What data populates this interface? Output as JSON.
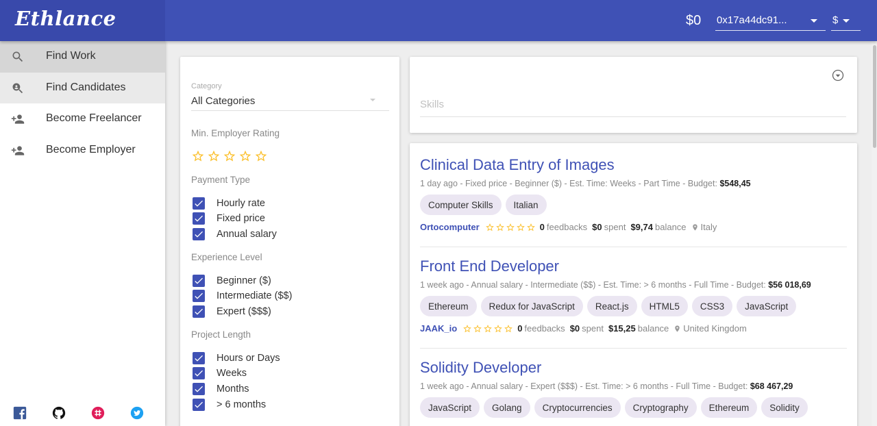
{
  "header": {
    "logo": "Ethlance",
    "balance": "$0",
    "address": "0x17a44dc91...",
    "currency": "$"
  },
  "sidebar": {
    "items": [
      {
        "label": "Find Work",
        "icon": "search-icon"
      },
      {
        "label": "Find Candidates",
        "icon": "person-search-icon"
      },
      {
        "label": "Become Freelancer",
        "icon": "person-add-icon"
      },
      {
        "label": "Become Employer",
        "icon": "person-add-icon"
      }
    ],
    "social": [
      {
        "icon": "facebook-icon",
        "color": "#3b5998"
      },
      {
        "icon": "github-icon",
        "color": "#111111"
      },
      {
        "icon": "slack-icon",
        "color": "#e01e5a"
      },
      {
        "icon": "twitter-icon",
        "color": "#1da1f2"
      }
    ]
  },
  "filters": {
    "category_label": "Category",
    "category_value": "All Categories",
    "min_rating_label": "Min. Employer Rating",
    "min_rating": 0,
    "payment_label": "Payment Type",
    "payment": [
      "Hourly rate",
      "Fixed price",
      "Annual salary"
    ],
    "experience_label": "Experience Level",
    "experience": [
      "Beginner ($)",
      "Intermediate ($$)",
      "Expert ($$$)"
    ],
    "length_label": "Project Length",
    "length": [
      "Hours or Days",
      "Weeks",
      "Months",
      "> 6 months"
    ]
  },
  "skills": {
    "placeholder": "Skills"
  },
  "jobs": [
    {
      "title": "Clinical Data Entry of Images",
      "meta": "1 day ago - Fixed price - Beginner ($) - Est. Time: Weeks - Part Time - Budget: ",
      "budget": "$548,45",
      "skills": [
        "Computer Skills",
        "Italian"
      ],
      "employer": "Ortocomputer",
      "rating": 0,
      "feedbacks_count": "0",
      "feedbacks_label": "feedbacks",
      "spent": "$0",
      "spent_label": "spent",
      "balance": "$9,74",
      "balance_label": "balance",
      "country": "Italy"
    },
    {
      "title": "Front End Developer",
      "meta": "1 week ago - Annual salary - Intermediate ($$) - Est. Time: > 6 months - Full Time - Budget: ",
      "budget": "$56 018,69",
      "skills": [
        "Ethereum",
        "Redux for JavaScript",
        "React.js",
        "HTML5",
        "CSS3",
        "JavaScript"
      ],
      "employer": "JAAK_io",
      "rating": 0,
      "feedbacks_count": "0",
      "feedbacks_label": "feedbacks",
      "spent": "$0",
      "spent_label": "spent",
      "balance": "$15,25",
      "balance_label": "balance",
      "country": "United Kingdom"
    },
    {
      "title": "Solidity Developer",
      "meta": "1 week ago - Annual salary - Expert ($$$) - Est. Time: > 6 months - Full Time - Budget: ",
      "budget": "$68 467,29",
      "skills": [
        "JavaScript",
        "Golang",
        "Cryptocurrencies",
        "Cryptography",
        "Ethereum",
        "Solidity"
      ]
    }
  ],
  "colors": {
    "primary": "#3f51b5",
    "logo_bg": "#3949ab",
    "star": "#fbc02d",
    "chip": "#ebe6f2"
  }
}
